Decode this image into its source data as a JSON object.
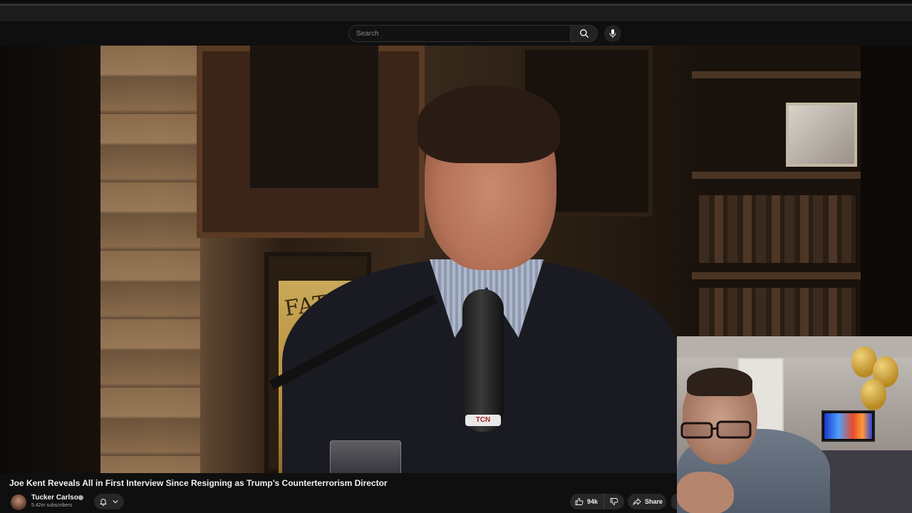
{
  "browser": {
    "tabs": []
  },
  "header": {
    "search": {
      "placeholder": "Search",
      "value": ""
    },
    "icons": {
      "search": "search-icon",
      "mic": "mic-icon"
    }
  },
  "video": {
    "poster_text": "FATIM",
    "mic_label": "TCN"
  },
  "info": {
    "title": "Joe Kent Reveals All in First Interview Since Resigning as Trump’s Counterterrorism Director",
    "channel": {
      "name": "Tucker Carlson",
      "subscribers": "5.42m subscribers",
      "verified": true
    },
    "actions": {
      "likes": "94k",
      "share_label": "Share"
    }
  },
  "colors": {
    "background": "#0f0f0f",
    "button_bg": "#272727",
    "text": "#f1f1f1",
    "muted": "#aaaaaa"
  }
}
